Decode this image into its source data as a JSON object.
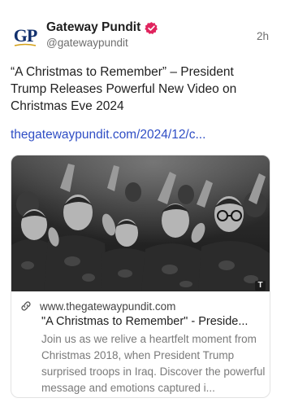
{
  "author": {
    "avatar_initials": "GP",
    "display_name": "Gateway Pundit",
    "handle": "@gatewaypundit",
    "verified_icon": "verified-badge-icon",
    "verified_color": "#e0245e",
    "brand_color": "#12306e"
  },
  "post": {
    "time": "2h",
    "text": "“A Christmas to Remember” – President Trump Releases Powerful New Video on Christmas Eve 2024",
    "link_text": "thegatewaypundit.com/2024/12/c...",
    "link_color": "#2f4ec5"
  },
  "link_card": {
    "image_badge": "T",
    "link_icon": "link-icon",
    "domain": "www.thegatewaypundit.com",
    "title": "\"A Christmas to Remember\" - Preside...",
    "description": "Join us as we relive a heartfelt moment from Christmas 2018, when President Trump surprised troops in Iraq. Discover the powerful message and emotions captured i..."
  }
}
